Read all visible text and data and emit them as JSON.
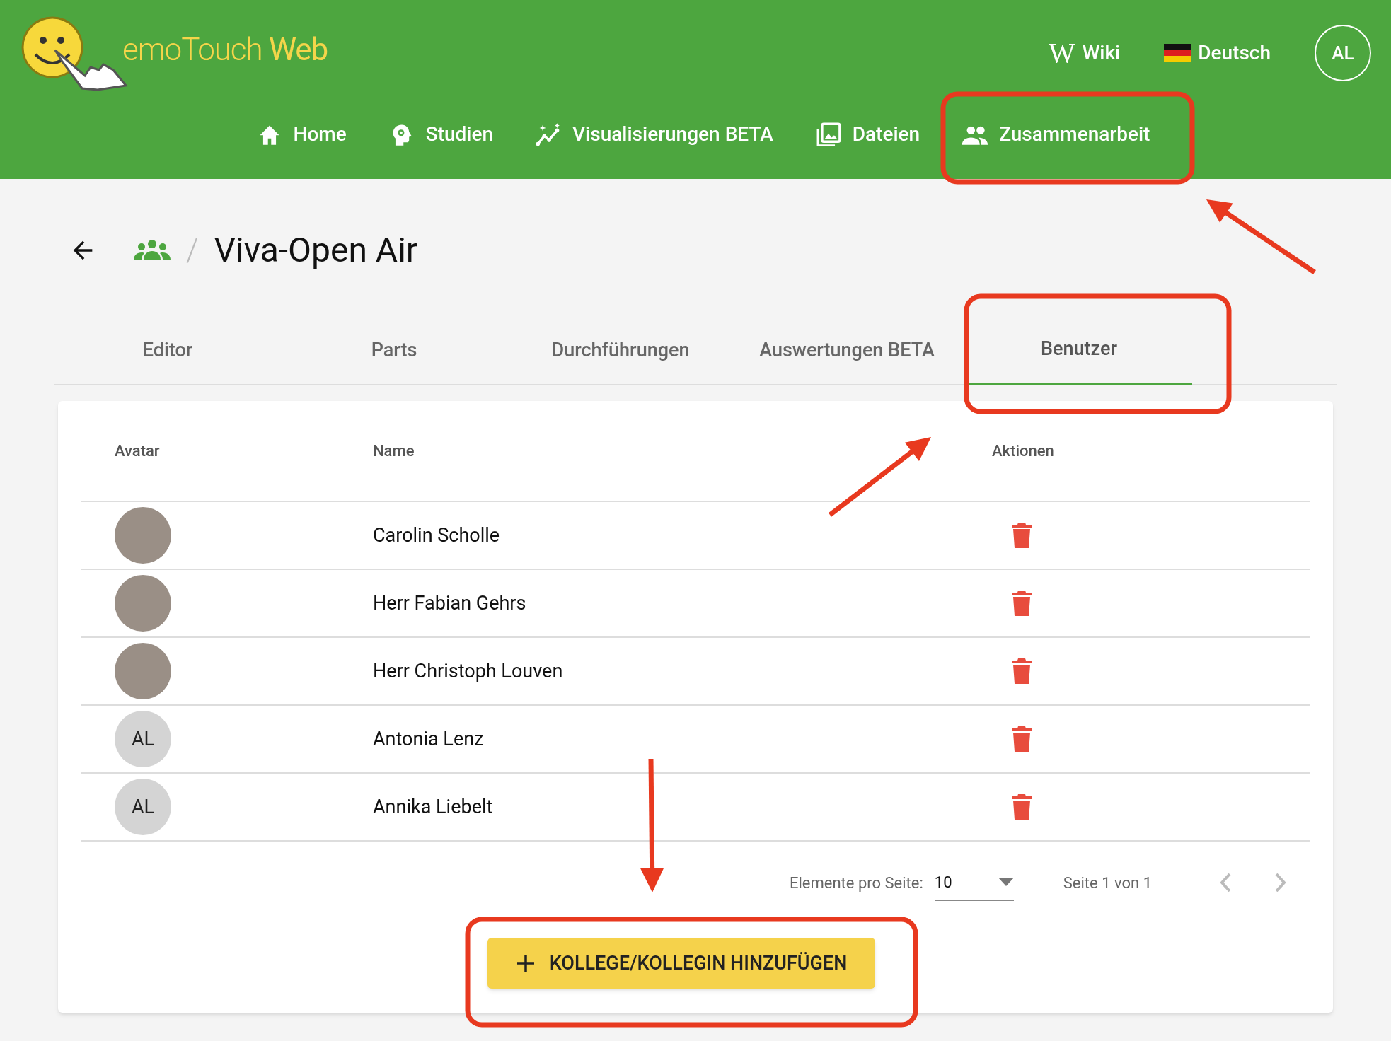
{
  "header": {
    "logo_text": "emoTouch **Web**",
    "links": [
      {
        "kind": "wiki",
        "icon_text": "W",
        "label": "Wiki"
      },
      {
        "kind": "language",
        "label": "Deutsch"
      }
    ],
    "account_initials": "AL"
  },
  "nav": [
    {
      "label": "Home"
    },
    {
      "label": "Studien"
    },
    {
      "label": "Visualisierungen BETA"
    },
    {
      "label": "Dateien"
    },
    {
      "label": "Zusammenarbeit"
    }
  ],
  "breadcrumb_separator": "/",
  "page_title": "Viva-Open Air",
  "tabs": [
    {
      "label": "Editor",
      "selected": false
    },
    {
      "label": "Parts",
      "selected": false
    },
    {
      "label": "Durchführungen",
      "selected": false
    },
    {
      "label": "Auswertungen BETA",
      "selected": false
    },
    {
      "label": "Benutzer",
      "selected": true
    }
  ],
  "table": {
    "columns": [
      "Avatar",
      "Name",
      "Aktionen"
    ],
    "rows": [
      {
        "avatar": {
          "kind": "photo"
        },
        "name": "Carolin Scholle"
      },
      {
        "avatar": {
          "kind": "photo"
        },
        "name": "Herr Fabian Gehrs"
      },
      {
        "avatar": {
          "kind": "photo"
        },
        "name": "Herr Christoph Louven"
      },
      {
        "avatar": {
          "kind": "initials",
          "text": "AL"
        },
        "name": "Antonia Lenz"
      },
      {
        "avatar": {
          "kind": "initials",
          "text": "AL"
        },
        "name": "Annika Liebelt"
      }
    ]
  },
  "pagination": {
    "label": "Elemente pro Seite:",
    "page_size": "10",
    "range": "Seite 1 von 1"
  },
  "add_button": {
    "label": "KOLLEGE/KOLLEGIN HINZUFÜGEN"
  },
  "annotations": [
    {
      "kind": "box"
    },
    {
      "kind": "arrow"
    },
    {
      "kind": "box"
    },
    {
      "kind": "arrow"
    },
    {
      "kind": "arrow"
    },
    {
      "kind": "box"
    }
  ]
}
